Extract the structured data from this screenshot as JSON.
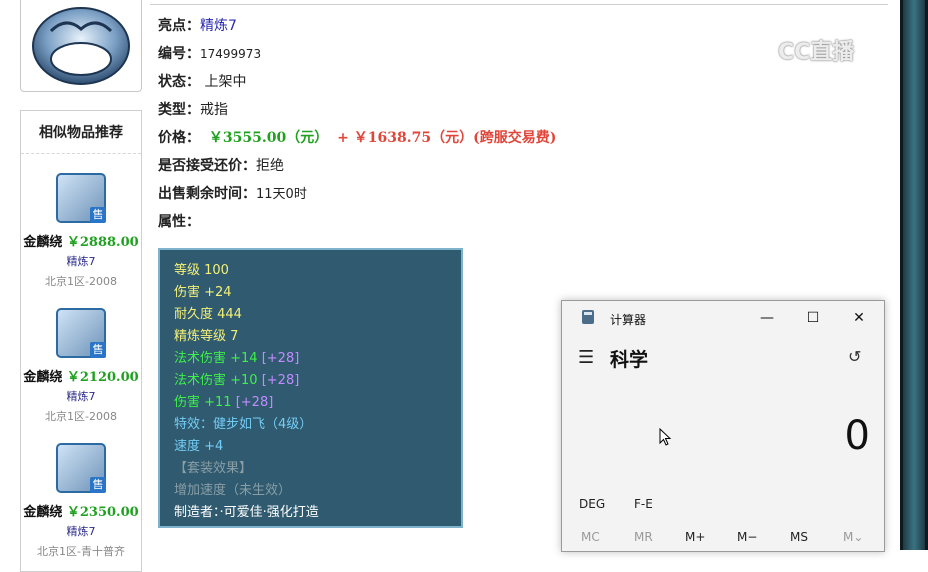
{
  "item": {
    "highlight_label": "亮点：",
    "highlight_value": "精炼7",
    "id_label": "编号：",
    "id_value": "17499973",
    "status_label": "状态：",
    "status_value": "上架中",
    "type_label": "类型：",
    "type_value": "戒指",
    "price_label": "价格：",
    "price_value": "￥3555.00（元）",
    "price_fee": "+ ￥1638.75（元）(跨服交易费)",
    "bargain_label": "是否接受还价：",
    "bargain_value": "拒绝",
    "remaining_label": "出售剩余时间：",
    "remaining_value": "11天0时",
    "attr_label": "属性："
  },
  "attributes": [
    {
      "text": "等级 100",
      "color": "#f3f07a"
    },
    {
      "text": "伤害 +24",
      "color": "#f3f07a"
    },
    {
      "text": "耐久度 444",
      "color": "#f3f07a"
    },
    {
      "text": "精炼等级 7",
      "color": "#f3f07a"
    },
    {
      "text": "法术伤害 +14",
      "extra": "[+28]",
      "color": "#3ef04a"
    },
    {
      "text": "法术伤害 +10",
      "extra": "[+28]",
      "color": "#3ef04a"
    },
    {
      "text": "伤害 +11",
      "extra": "[+28]",
      "color": "#3ef04a"
    },
    {
      "text": "特效：健步如飞（4级）",
      "color": "#74cdf6"
    },
    {
      "text": "速度 +4",
      "color": "#74cdf6"
    },
    {
      "text": "【套装效果】",
      "color": "#8a9ea6"
    },
    {
      "text": "增加速度（未生效）",
      "color": "#8a9ea6"
    },
    {
      "text": "制造者：·可爱佳·强化打造",
      "color": "#ffffff"
    }
  ],
  "recommend": {
    "title": "相似物品推荐",
    "sale_badge": "售",
    "items": [
      {
        "name": "金麟绕",
        "price": "￥2888.00",
        "refine": "精炼7",
        "server": "北京1区-2008"
      },
      {
        "name": "金麟绕",
        "price": "￥2120.00",
        "refine": "精炼7",
        "server": "北京1区-2008"
      },
      {
        "name": "金麟绕",
        "price": "￥2350.00",
        "refine": "精炼7",
        "server": "北京1区-青十普齐"
      }
    ]
  },
  "watermark": "CC直播",
  "calculator": {
    "title": "计算器",
    "mode": "科学",
    "display": "0",
    "deg": "DEG",
    "fe": "F-E",
    "memory": [
      "MC",
      "MR",
      "M+",
      "M−",
      "MS",
      "M⌄"
    ]
  }
}
